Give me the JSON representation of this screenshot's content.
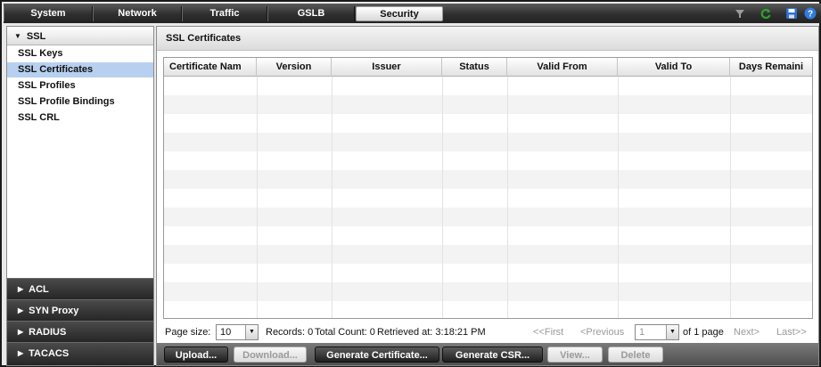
{
  "top_tabs": [
    {
      "label": "System",
      "active": false
    },
    {
      "label": "Network",
      "active": false
    },
    {
      "label": "Traffic",
      "active": false
    },
    {
      "label": "GSLB",
      "active": false
    },
    {
      "label": "Security",
      "active": true
    }
  ],
  "top_icons": [
    "filter-icon",
    "refresh-icon",
    "save-icon",
    "help-icon"
  ],
  "sidebar": {
    "header": "SSL",
    "items": [
      "SSL Keys",
      "SSL Certificates",
      "SSL Profiles",
      "SSL Profile Bindings",
      "SSL CRL"
    ],
    "selected_item": "SSL Certificates",
    "sections": [
      "ACL",
      "SYN Proxy",
      "RADIUS",
      "TACACS"
    ]
  },
  "main": {
    "title": "SSL Certificates",
    "columns": [
      "Certificate Nam",
      "Version",
      "Issuer",
      "Status",
      "Valid From",
      "Valid To",
      "Days Remaini"
    ],
    "rows": []
  },
  "pager": {
    "page_size_label": "Page size:",
    "page_size": "10",
    "records": "Records: 0",
    "total_count": "Total Count: 0",
    "retrieved": "Retrieved at: 3:18:21 PM",
    "first": "<<First",
    "previous": "<Previous",
    "page": "1",
    "of_pages": "of 1 page",
    "next": "Next>",
    "last": "Last>>"
  },
  "toolbar": {
    "buttons": [
      {
        "label": "Upload...",
        "enabled": true
      },
      {
        "label": "Download...",
        "enabled": false
      },
      {
        "label": "Generate Certificate...",
        "enabled": true
      },
      {
        "label": "Generate CSR...",
        "enabled": true
      },
      {
        "label": "View...",
        "enabled": false
      },
      {
        "label": "Delete",
        "enabled": false
      }
    ]
  },
  "colors": {
    "selected_row": "#b7d0f0",
    "refresh_icon": "#2aa52a",
    "help_icon": "#2f7be0",
    "save_icon": "#2f6fd0"
  }
}
